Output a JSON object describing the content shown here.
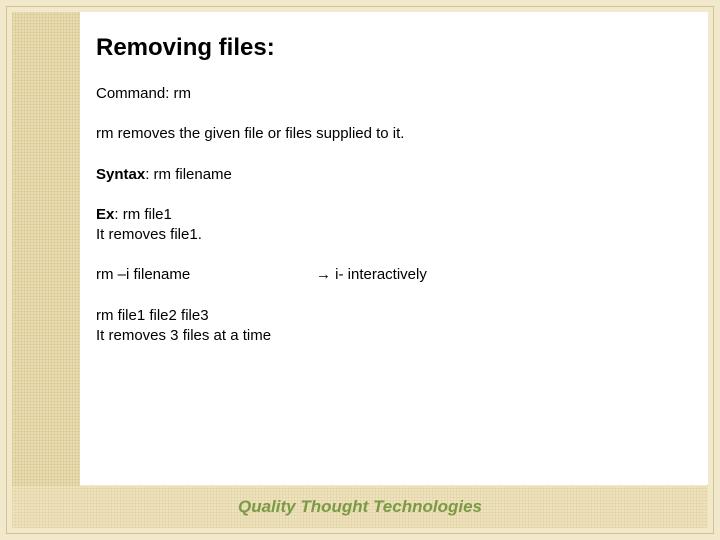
{
  "title": "Removing files:",
  "command": {
    "label": "Command: ",
    "value": "rm"
  },
  "description": "rm removes the given file or files supplied to it.",
  "syntax": {
    "label": "Syntax",
    "value": ": rm filename"
  },
  "example": {
    "label": "Ex",
    "cmd": ": rm file1",
    "result": "It removes file1."
  },
  "option": {
    "cmd": "rm –i filename",
    "arrow": "à",
    "desc": " i- interactively"
  },
  "multi": {
    "cmd": "rm file1 file2 file3",
    "result": "It removes 3 files at a time"
  },
  "footer": "Quality Thought Technologies"
}
